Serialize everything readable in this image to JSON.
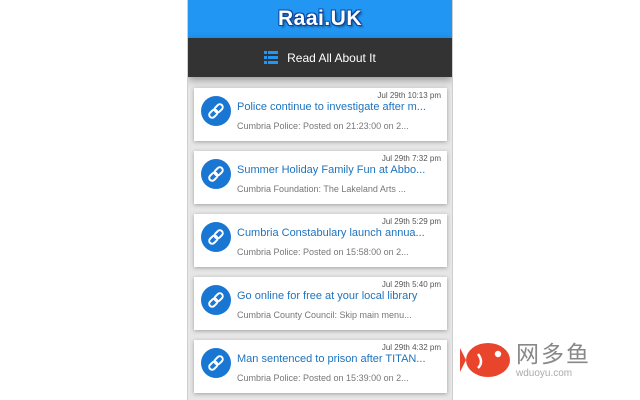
{
  "app": {
    "logo": "Raai.UK",
    "nav_label": "Read All About It"
  },
  "colors": {
    "accent": "#2196f3",
    "navbar": "#333333",
    "title_link": "#1e73be"
  },
  "icons": {
    "nav": "list-icon",
    "item": "link-icon"
  },
  "items": [
    {
      "time": "Jul 29th 10:13 pm",
      "title": "Police continue to investigate after m...",
      "snippet": "Cumbria Police: Posted on 21:23:00 on 2..."
    },
    {
      "time": "Jul 29th 7:32 pm",
      "title": "Summer Holiday Family Fun at Abbo...",
      "snippet": "Cumbria Foundation: The Lakeland Arts ..."
    },
    {
      "time": "Jul 29th 5:29 pm",
      "title": "Cumbria Constabulary launch annua...",
      "snippet": "Cumbria Police: Posted on 15:58:00 on 2..."
    },
    {
      "time": "Jul 29th 5:40 pm",
      "title": "Go online for free at your local library",
      "snippet": "Cumbria County Council: Skip main menu..."
    },
    {
      "time": "Jul 29th 4:32 pm",
      "title": "Man sentenced to prison after TITAN...",
      "snippet": "Cumbria Police: Posted on 15:39:00 on 2..."
    }
  ],
  "watermark": {
    "cn": "网多鱼",
    "url": "wduoyu.com"
  }
}
